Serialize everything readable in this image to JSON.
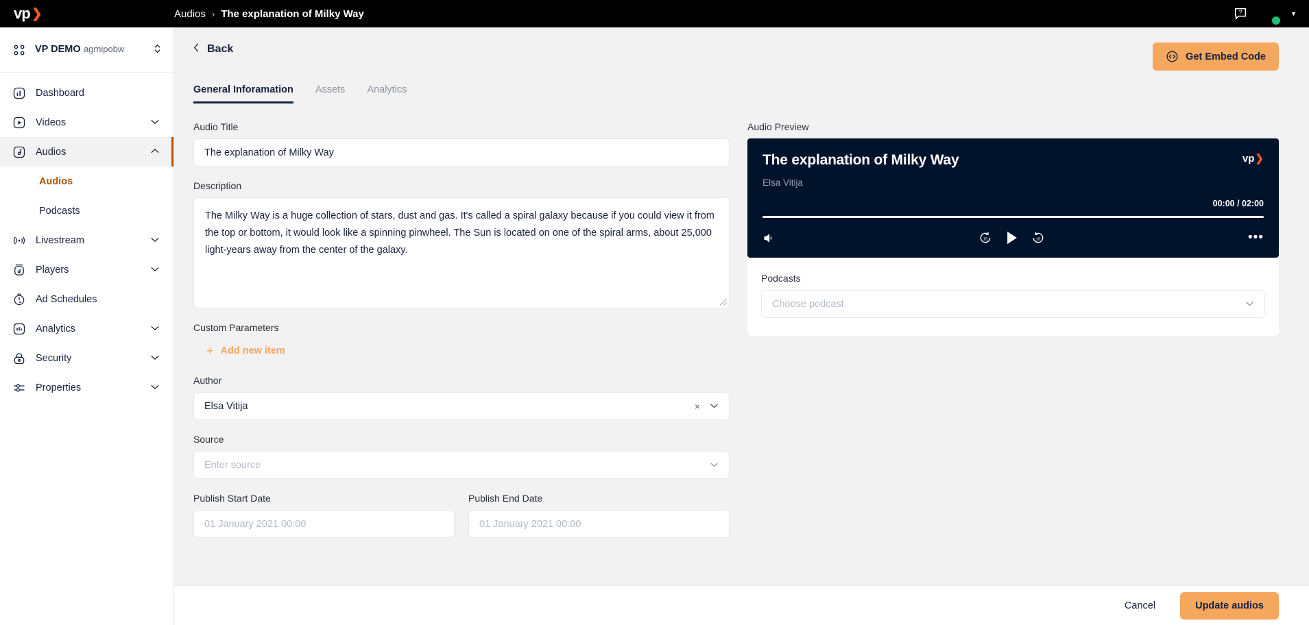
{
  "topbar": {
    "logo_text": "vp",
    "logo_chevron": "❯",
    "breadcrumb_parent": "Audios",
    "breadcrumb_sep": "›",
    "breadcrumb_current": "The explanation of Milky Way",
    "help_icon": "help-bubble-icon",
    "avatar_icon": "user-avatar",
    "caret": "▼"
  },
  "sidebar": {
    "workspace_name": "VP DEMO",
    "workspace_id": "agmipobw",
    "workspace_switch_icon": "up-down-chevron-icon",
    "items": [
      {
        "label": "Dashboard",
        "icon": "dashboard-icon",
        "expandable": false
      },
      {
        "label": "Videos",
        "icon": "video-icon",
        "expandable": true
      },
      {
        "label": "Audios",
        "icon": "audio-icon",
        "expandable": true,
        "active": true,
        "expanded": true
      },
      {
        "label": "Livestream",
        "icon": "livestream-icon",
        "expandable": true
      },
      {
        "label": "Players",
        "icon": "players-icon",
        "expandable": true
      },
      {
        "label": "Ad Schedules",
        "icon": "ad-schedules-icon",
        "expandable": false
      },
      {
        "label": "Analytics",
        "icon": "analytics-icon",
        "expandable": true
      },
      {
        "label": "Security",
        "icon": "security-lock-icon",
        "expandable": true
      },
      {
        "label": "Properties",
        "icon": "properties-sliders-icon",
        "expandable": true
      }
    ],
    "sub_items": [
      {
        "label": "Audios",
        "selected": true
      },
      {
        "label": "Podcasts",
        "selected": false
      }
    ],
    "chevron_down": "⌄",
    "chevron_up": "⌃"
  },
  "main": {
    "back_label": "Back",
    "back_chevron": "‹",
    "embed_button": "Get Embed Code",
    "embed_icon": "code-embed-icon",
    "tabs": [
      {
        "label": "General Inforamation",
        "active": true
      },
      {
        "label": "Assets",
        "active": false
      },
      {
        "label": "Analytics",
        "active": false
      }
    ],
    "fields": {
      "audio_title_label": "Audio Title",
      "audio_title_value": "The explanation of Milky Way",
      "description_label": "Description",
      "description_value": "The Milky Way is a huge collection of stars, dust and gas. It's called a spiral galaxy because if you could view it from the top or bottom, it would look like a spinning pinwheel. The Sun is located on one of the spiral arms, about 25,000 light-years away from the center of the galaxy.",
      "custom_parameters_label": "Custom Parameters",
      "add_new_item_label": "Add new item",
      "add_new_item_icon": "plus-icon",
      "author_label": "Author",
      "author_value": "Elsa Vitija",
      "author_clear_icon": "×",
      "source_label": "Source",
      "source_placeholder": "Enter source",
      "publish_start_label": "Publish Start Date",
      "publish_start_placeholder": "01 January 2021 00:00",
      "publish_end_label": "Publish End Date",
      "publish_end_placeholder": "01 January 2021 00:00"
    },
    "preview": {
      "section_label": "Audio Preview",
      "title": "The explanation of Milky Way",
      "author": "Elsa Vitija",
      "time_display": "00:00 / 02:00",
      "current_time": "00:00",
      "duration": "02:00",
      "progress_percent": 0,
      "volume_icon": "volume-icon",
      "rewind_icon": "rewind-15-icon",
      "play_icon": "play-icon",
      "forward_icon": "forward-15-icon",
      "more_icon": "more-options-icon",
      "logo_text": "vp",
      "logo_chevron": "❯"
    },
    "podcasts": {
      "label": "Podcasts",
      "placeholder": "Choose podcast",
      "chevron_icon": "chevron-down-icon"
    }
  },
  "footer": {
    "cancel_label": "Cancel",
    "update_label": "Update audios"
  },
  "colors": {
    "accent_orange": "#f5a75e",
    "logo_orange": "#f05a28",
    "active_sub_orange": "#b4540a",
    "player_bg": "#01122b",
    "dark_navy": "#16213e",
    "page_bg": "#f2f2f2",
    "status_green": "#21bf73"
  }
}
